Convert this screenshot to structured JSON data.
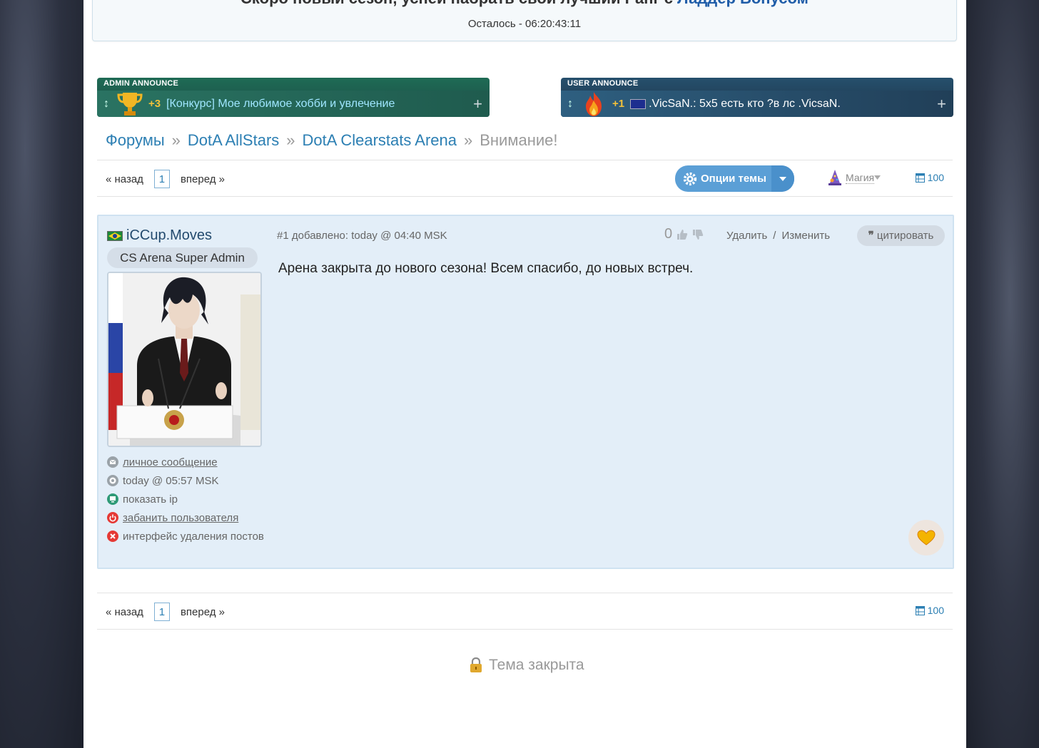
{
  "banner": {
    "title_prefix": "Скоро новый сезон, успей набрать свой лучший Ранг с ",
    "title_link": "Ладдер Бонусом",
    "timer": "Осталось - 06:20:43:11"
  },
  "announcements": {
    "admin": {
      "label": "ADMIN ANNOUNCE",
      "score": "+3",
      "text": "[Конкурс] Мое любимое хобби и увлечение"
    },
    "user": {
      "label": "USER ANNOUNCE",
      "score": "+1",
      "text": ".VicSaN.:  5x5 есть кто ?в лс .VicsaN."
    }
  },
  "breadcrumb": {
    "items": [
      "Форумы",
      "DotA AllStars",
      "DotA Clearstats Arena"
    ],
    "separator": "»",
    "current": "Внимание!"
  },
  "pager": {
    "prev": "« назад",
    "page": "1",
    "next": "вперед »",
    "count": "100"
  },
  "toolbar": {
    "options_label": "Опции темы",
    "magic_label": "Магия"
  },
  "post": {
    "author": "iCCup.Moves",
    "rank": "CS Arena Super Admin",
    "meta": "#1 добавлено: today @ 04:40 MSK",
    "votes": "0",
    "delete_label": "Удалить",
    "edit_separator": "/",
    "edit_label": "Изменить",
    "quote_label": "цитировать",
    "body": "Арена закрыта до нового сезона! Всем спасибо, до новых встреч.",
    "links": {
      "pm": "личное сообщение",
      "last_seen": "today @ 05:57 MSK",
      "show_ip": "показать ip",
      "ban": "забанить пользователя",
      "delete_posts": "интерфейс удаления постов"
    }
  },
  "footer": {
    "closed_label": "Тема закрыта"
  },
  "colors": {
    "link": "#2c7fb3",
    "admin_announce": "#1f6b55",
    "user_announce": "#26506d",
    "options_button": "#5b9fd6",
    "post_bg": "#e3eef8"
  }
}
